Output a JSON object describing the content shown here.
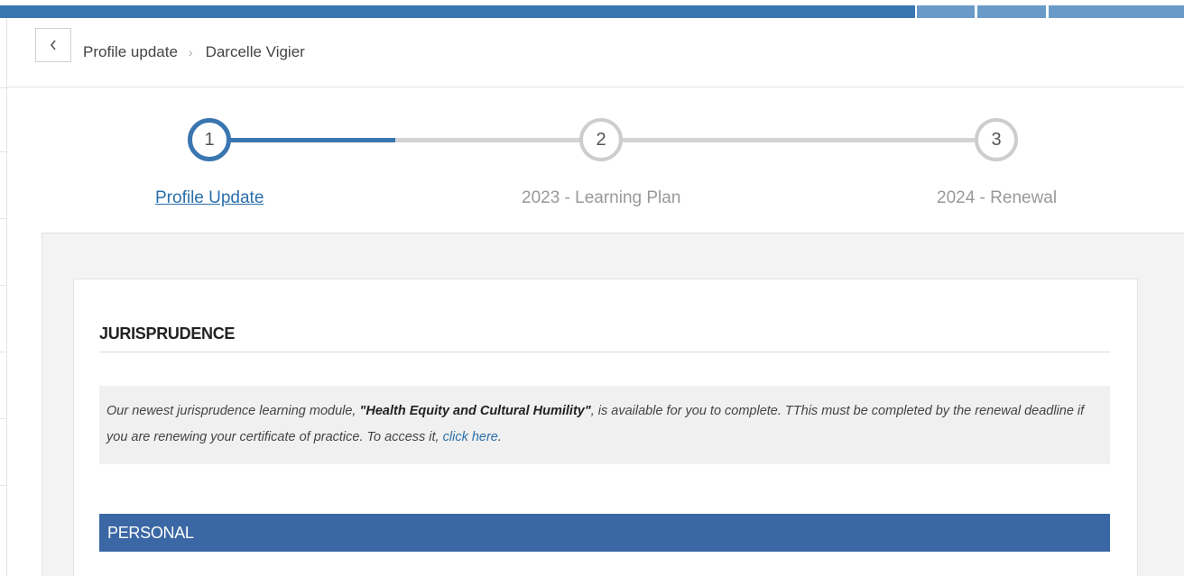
{
  "header": {
    "breadcrumb_root": "Profile update",
    "breadcrumb_separator": "›",
    "breadcrumb_current": "Darcelle Vigier",
    "back_icon": "chevron-left-icon"
  },
  "stepper": {
    "steps": [
      {
        "number": "1",
        "label": "Profile Update",
        "state": "active"
      },
      {
        "number": "2",
        "label": "2023 - Learning Plan",
        "state": "pending"
      },
      {
        "number": "3",
        "label": "2024 - Renewal",
        "state": "pending"
      }
    ]
  },
  "jurisprudence": {
    "title": "JURISPRUDENCE",
    "text_before": "Our newest jurisprudence learning module, ",
    "module_name": "\"Health Equity and Cultural Humility\"",
    "text_after": ", is available for you to complete. TThis must be completed by the renewal deadline if you are renewing your certificate of practice. To access it, ",
    "link_text": "click here",
    "text_end": "."
  },
  "personal": {
    "title": "PERSONAL"
  },
  "colors": {
    "primary": "#3a76b0",
    "section_bar": "#3b67a4",
    "link": "#2a6fab",
    "inactive_step": "#cdcdcd"
  }
}
